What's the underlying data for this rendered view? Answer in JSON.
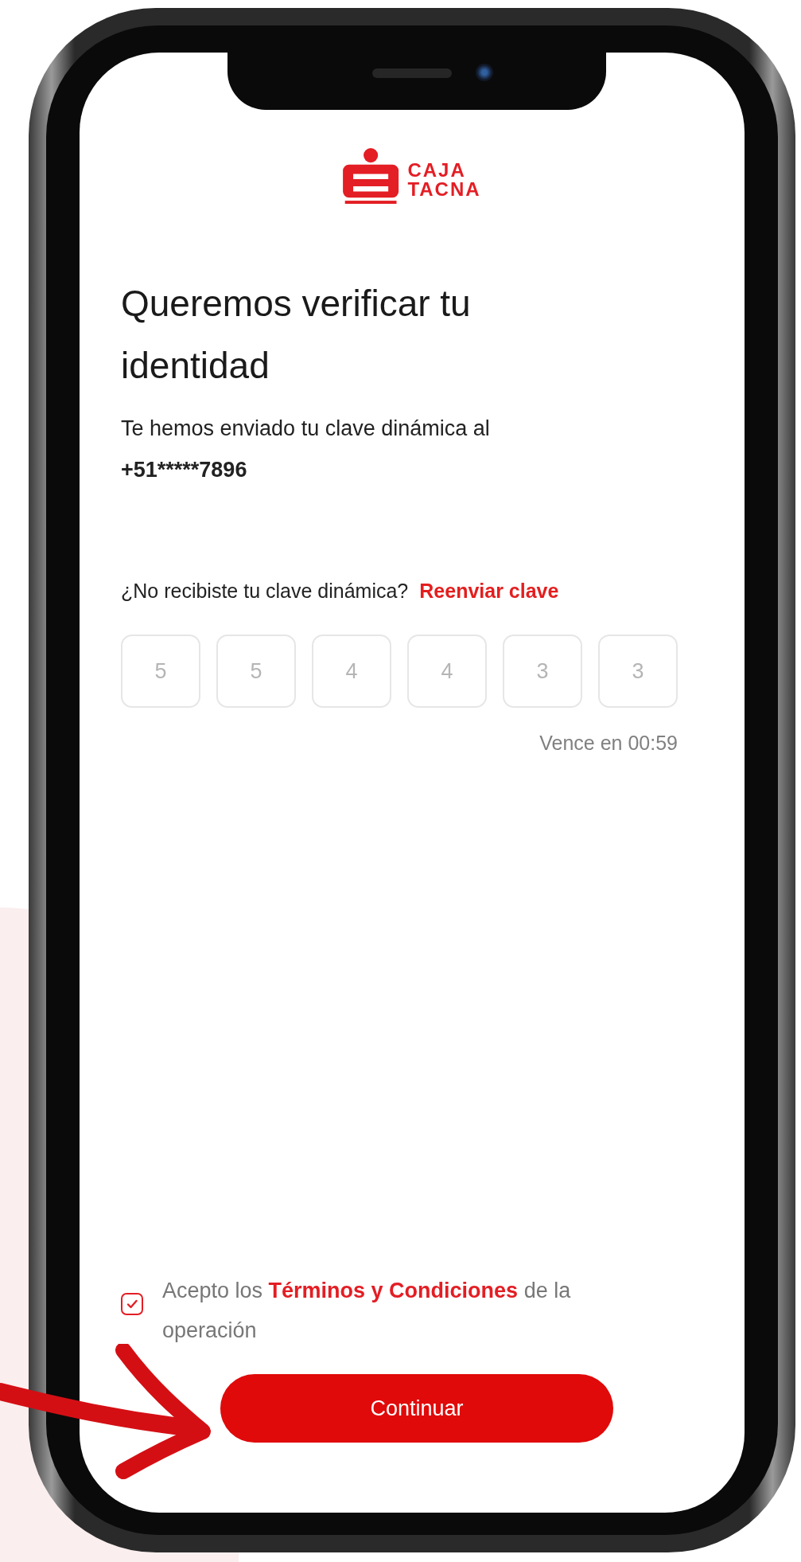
{
  "logo": {
    "line_1": "CAJA",
    "line_2": "TACNA"
  },
  "title": "Queremos verificar tu identidad",
  "message": "Te hemos enviado tu clave dinámica al",
  "phone_number": "+51*****7896",
  "resend_prompt": "¿No recibiste tu clave dinámica?",
  "resend_link": "Reenviar clave",
  "code_digits": [
    "5",
    "5",
    "4",
    "4",
    "3",
    "3"
  ],
  "expiry": "Vence en 00:59",
  "terms": {
    "checked": true,
    "text_before": "Acepto los",
    "link": "Términos y Condiciones",
    "text_after": "de la operación"
  },
  "continue_button": "Continuar"
}
